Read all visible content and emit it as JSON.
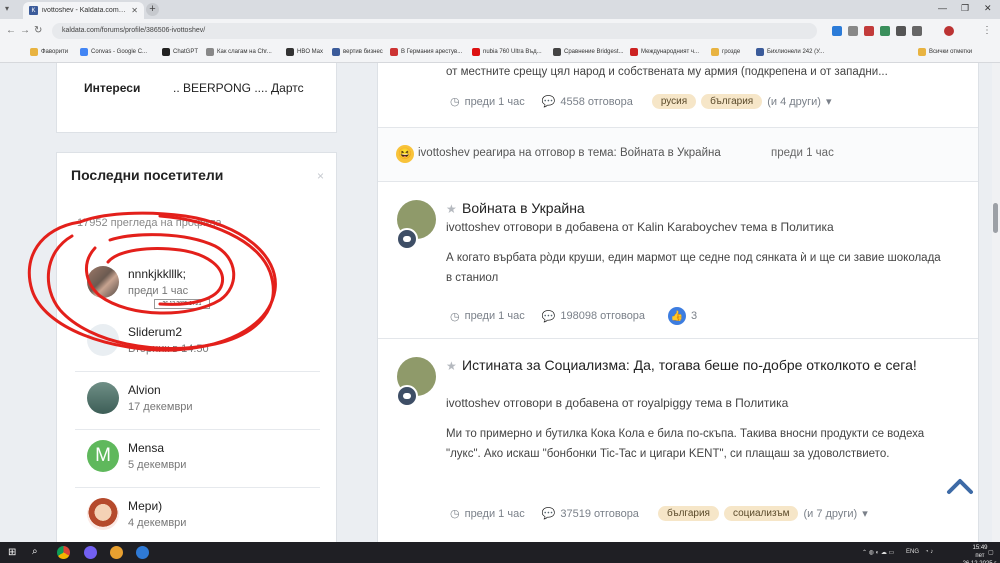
{
  "browser": {
    "tab_title": "ivottoshev - Kaldata.com - Фор...",
    "url": "kaldata.com/forums/profile/386506-ivottoshev/",
    "bookmarks": [
      "Фаворити",
      "Convas - Google C...",
      "ChatGPT",
      "Как слагам на Chr...",
      "HBO Max",
      "вертив бизнес",
      "В Германия арестув...",
      "nubia 760 Ultra Въд...",
      "Сравнение Bridgest...",
      "Международният ч...",
      "грозде",
      "Бихлионели 242 (У...",
      "Всички отметки"
    ]
  },
  "sidebar": {
    "interests": {
      "label": "Интереси",
      "value": ".. BEERPONG .... Дартс"
    },
    "visitors": {
      "title": "Последни посетители",
      "close": "×",
      "count_text": "17952 прегледа на профила",
      "tooltip": "26.12.2025 14:21",
      "items": [
        {
          "name": "nnnkjkklllk;",
          "time": "преди 1 час"
        },
        {
          "name": "Sliderum2",
          "time": "Вторник в 14:50"
        },
        {
          "name": "Alvion",
          "time": "17 декември"
        },
        {
          "name": "Mensa",
          "time": "5 декември",
          "initial": "M"
        },
        {
          "name": "Мери)",
          "time": "4 декември"
        }
      ]
    }
  },
  "feed": {
    "item0": {
      "body_tail": "от местните срещу цял народ и собствената му армия (подкрепена и от западни...",
      "time": "преди 1 час",
      "replies": "4558 отговора",
      "tags": [
        "русия",
        "българия"
      ],
      "more": "(и 4 други)"
    },
    "reaction": {
      "text": "ivottoshev реагира на отговор в тема: Войната в Украйна",
      "time": "преди 1 час"
    },
    "item1": {
      "title": "Войната в Украйна",
      "subtitle": "ivottoshev отговори в добавена от Kalin Karaboychev тема в Политика",
      "body": "А когато върбата ро̀ди круши, един мармот ще седне под сянката ѝ и ще си завие шоколада в станиол",
      "time": "преди 1 час",
      "replies": "198098 отговора",
      "likes": "3"
    },
    "item2": {
      "title": "Истината за Социализма: Да, тогава беше по-добре отколкото е сега!",
      "subtitle": "ivottoshev отговори в добавена от royalpiggy тема в Политика",
      "body": "Ми то примерно и бутилка Кока Кола е била по-скъпа. Такива вносни продукти се водеха \"лукс\". Ако искаш \"бонбонки Tic-Tac и цигари KENT\", си плащаш за удоволствието.",
      "time": "преди 1 час",
      "replies": "37519 отговора",
      "tags": [
        "българия",
        "социализъм"
      ],
      "more": "(и 7 други)"
    }
  },
  "taskbar": {
    "lang": "ENG",
    "time": "15:49",
    "date": "пет 26.12.2025 г."
  },
  "colors": {
    "accent": "#3d6aa6",
    "tag_bg": "#f6e6c8",
    "annotation": "#e3201b"
  }
}
